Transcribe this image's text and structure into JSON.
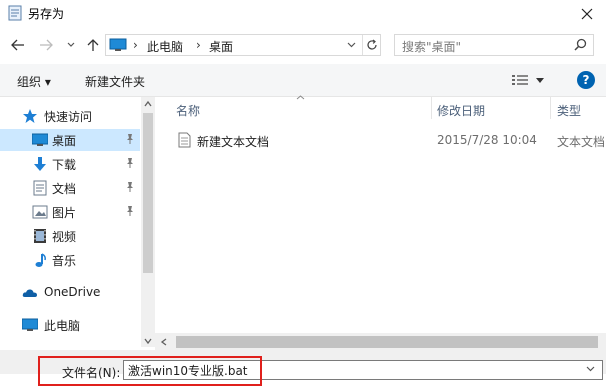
{
  "window": {
    "title": "另存为"
  },
  "address": {
    "path": [
      "此电脑",
      "桌面"
    ]
  },
  "search": {
    "placeholder": "搜索\"桌面\""
  },
  "toolbar": {
    "organize_label": "组织 ▾",
    "new_folder_label": "新建文件夹"
  },
  "sidebar": {
    "quick_access_label": "快速访问",
    "items": [
      {
        "label": "桌面",
        "icon": "desktop-icon",
        "pinned": true,
        "selected": true
      },
      {
        "label": "下载",
        "icon": "download-icon",
        "pinned": true
      },
      {
        "label": "文档",
        "icon": "document-icon",
        "pinned": true
      },
      {
        "label": "图片",
        "icon": "picture-icon",
        "pinned": true
      },
      {
        "label": "视频",
        "icon": "video-icon",
        "pinned": false
      },
      {
        "label": "音乐",
        "icon": "music-icon",
        "pinned": false
      }
    ],
    "onedrive_label": "OneDrive",
    "thispc_label": "此电脑"
  },
  "file_list": {
    "columns": [
      "名称",
      "修改日期",
      "类型"
    ],
    "rows": [
      {
        "name": "新建文本文档",
        "modified": "2015/7/28 10:04",
        "type": "文本文档"
      }
    ]
  },
  "bottom": {
    "filename_label": "文件名(N):",
    "filename_value": "激活win10专业版.bat"
  },
  "colors": {
    "selected_bg": "#cce8ff",
    "accent": "#0063b1",
    "highlight": "#e0201c"
  }
}
